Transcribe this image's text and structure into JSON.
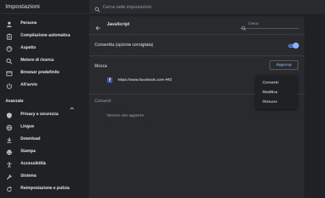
{
  "app": {
    "title": "Impostazioni"
  },
  "search": {
    "placeholder": "Cerca nelle impostazioni"
  },
  "sidebar": {
    "items": [
      {
        "label": "Persone",
        "icon": "person-icon"
      },
      {
        "label": "Compilazione automatica",
        "icon": "clipboard-icon"
      },
      {
        "label": "Aspetto",
        "icon": "palette-icon"
      },
      {
        "label": "Motore di ricerca",
        "icon": "search-icon"
      },
      {
        "label": "Browser predefinito",
        "icon": "browser-icon"
      },
      {
        "label": "All'avvio",
        "icon": "power-icon"
      }
    ],
    "advanced": {
      "label": "Avanzate",
      "items": [
        {
          "label": "Privacy e sicurezza",
          "icon": "shield-icon"
        },
        {
          "label": "Lingue",
          "icon": "globe-icon"
        },
        {
          "label": "Download",
          "icon": "download-icon"
        },
        {
          "label": "Stampa",
          "icon": "printer-icon"
        },
        {
          "label": "Accessibilità",
          "icon": "accessibility-icon"
        },
        {
          "label": "Sistema",
          "icon": "wrench-icon"
        },
        {
          "label": "Reimpostazione e pulizia",
          "icon": "reset-icon"
        }
      ]
    }
  },
  "page": {
    "title": "JavaScript",
    "search_placeholder": "Cerca",
    "allow_label": "Consentita (opzione consigliata)",
    "allow_enabled": true,
    "block_section": "Blocca",
    "add_button": "Aggiungi",
    "blocked_sites": [
      {
        "url": "https://www.facebook.com:443",
        "icon": "facebook-icon"
      }
    ],
    "allow_section": "Consenti",
    "no_sites": "Nessun sito aggiunto"
  },
  "context_menu": {
    "items": [
      {
        "label": "Consenti"
      },
      {
        "label": "Modifica"
      },
      {
        "label": "Rimuovi"
      }
    ]
  },
  "colors": {
    "accent": "#8ab4f8",
    "background": "#202124",
    "panel": "#292a2d"
  }
}
